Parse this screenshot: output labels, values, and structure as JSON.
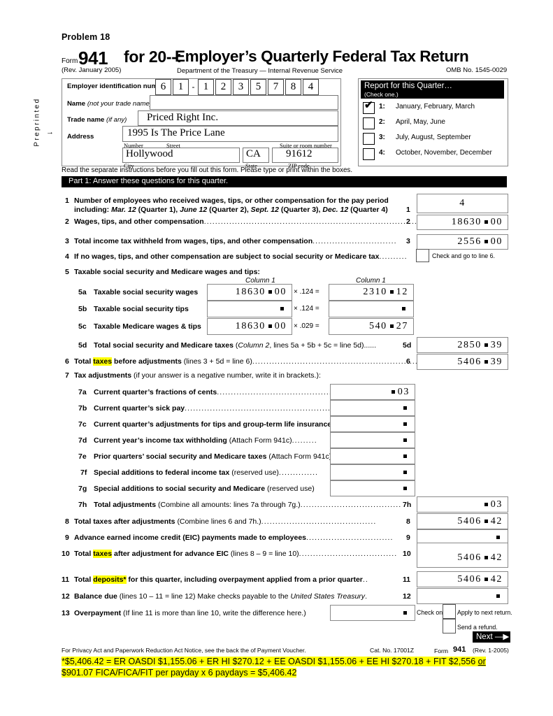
{
  "document": {
    "problem_title": "Problem 18",
    "form_word": "Form",
    "form_number": "941",
    "form_for_year": "for 20--:",
    "form_title": "Employer’s Quarterly Federal Tax Return",
    "revision": "(Rev. January 2005)",
    "department": "Department of the Treasury — Internal Revenue Service",
    "omb": "OMB No. 1545-0029",
    "preprinted_label": "Preprinted",
    "preprinted_arrow": "→",
    "read_instructions": "Read the separate instructions before you fill out this form. Please type or print within the boxes."
  },
  "entity": {
    "ein_label": "Employer identification number",
    "ein_digits": [
      "6",
      "1",
      "1",
      "2",
      "3",
      "5",
      "7",
      "8",
      "4"
    ],
    "ein_separator": "-",
    "name_label": "Name",
    "name_hint": "(not your trade name)",
    "name_value": "",
    "trade_label": "Trade name",
    "trade_hint": "(if any)",
    "trade_value": "Priced Right Inc.",
    "address_label": "Address",
    "address_value": "1995 Is The Price Lane",
    "sub_number": "Number",
    "sub_street": "Street",
    "sub_suite": "Suite or room number",
    "city_value": "Hollywood",
    "state_value": "CA",
    "zip_value": "91612",
    "sub_city": "City",
    "sub_state": "State",
    "sub_zip": "ZIP code"
  },
  "quarter": {
    "title": "Report for this Quarter…",
    "subtitle": "(Check one.)",
    "checkmark": "✔",
    "options": [
      {
        "num": "1:",
        "label": "January, February, March",
        "checked": true
      },
      {
        "num": "2:",
        "label": "April, May, June",
        "checked": false
      },
      {
        "num": "3:",
        "label": "July, August, September",
        "checked": false
      },
      {
        "num": "4:",
        "label": "October, November, December",
        "checked": false
      }
    ]
  },
  "part1": {
    "header": "Part 1: Answer these questions for this quarter."
  },
  "lines": {
    "l1": {
      "num": "1",
      "text_a": "Number of employees who received wages, tips, or other compensation for the pay period",
      "text_b_pre": "including: ",
      "text_b_1": "Mar. 12",
      "text_b_2": " (Quarter 1), ",
      "text_b_3": "June 12",
      "text_b_4": " (Quarter 2), ",
      "text_b_5": "Sept. 12",
      "text_b_6": " (Quarter 3), ",
      "text_b_7": "Dec. 12",
      "text_b_8": " (Quarter 4)",
      "ref": "1",
      "value": "4"
    },
    "l2": {
      "num": "2",
      "text": "Wages, tips, and other compensation",
      "ref": "2",
      "whole": "18630",
      "cents": "00"
    },
    "l3": {
      "num": "3",
      "text": "Total income tax withheld from wages, tips, and other compensation",
      "ref": "3",
      "whole": "2556",
      "cents": "00"
    },
    "l4": {
      "num": "4",
      "text": "If no wages, tips, and other compensation are subject to social security or Medicare tax",
      "note": "Check and go to line 6."
    },
    "l5": {
      "num": "5",
      "text": "Taxable social security and Medicare wages and tips:",
      "col1": "Column 1",
      "col2": "Column 1"
    },
    "l5a": {
      "num": "5a",
      "text": "Taxable social security wages",
      "c1_whole": "18630",
      "c1_cents": "00",
      "mult": "× .124 =",
      "c2_whole": "2310",
      "c2_cents": "12"
    },
    "l5b": {
      "num": "5b",
      "text": "Taxable social security tips",
      "c1_whole": "",
      "c1_cents": "",
      "mult": "× .124 =",
      "c2_whole": "",
      "c2_cents": ""
    },
    "l5c": {
      "num": "5c",
      "text": "Taxable Medicare wages & tips",
      "c1_whole": "18630",
      "c1_cents": "00",
      "mult": "× .029 =",
      "c2_whole": "540",
      "c2_cents": "27"
    },
    "l5d": {
      "num": "5d",
      "text": "Total social security and Medicare taxes",
      "paren_i": "Column 2",
      "paren_r": ", lines 5a + 5b + 5c = line 5d)......",
      "ref": "5d",
      "whole": "2850",
      "cents": "39"
    },
    "l6": {
      "num": "6",
      "t1": "Total ",
      "hl": "taxes",
      "t2": " before adjustments ",
      "paren": "(lines 3 + 5d = line 6)",
      "ref": "6",
      "whole": "5406",
      "cents": "39"
    },
    "l7": {
      "num": "7",
      "text": "Tax adjustments ",
      "paren": "(if your answer is a negative number, write it in brackets.):"
    },
    "l7a": {
      "num": "7a",
      "text": "Current quarter’s fractions of cents",
      "whole": "",
      "cents": "03"
    },
    "l7b": {
      "num": "7b",
      "text": "Current quarter’s sick pay",
      "whole": "",
      "cents": ""
    },
    "l7c": {
      "num": "7c",
      "text": "Current quarter’s adjustments for tips and group-term life insurance",
      "whole": "",
      "cents": ""
    },
    "l7d": {
      "num": "7d",
      "text": "Current year’s income tax withholding ",
      "paren": "(Attach Form 941c)",
      "whole": "",
      "cents": ""
    },
    "l7e": {
      "num": "7e",
      "text": "Prior quarters’ social security and Medicare taxes ",
      "paren": "(Attach Form 941c)",
      "whole": "",
      "cents": ""
    },
    "l7f": {
      "num": "7f",
      "text": "Special additions to federal income tax ",
      "paren": "(reserved use)",
      "whole": "",
      "cents": ""
    },
    "l7g": {
      "num": "7g",
      "text": "Special additions to social security and Medicare ",
      "paren": "(reserved use)",
      "whole": "",
      "cents": ""
    },
    "l7h": {
      "num": "7h",
      "text": "Total adjustments ",
      "paren": "(Combine all amounts: lines 7a through 7g.)",
      "ref": "7h",
      "whole": "",
      "cents": "03"
    },
    "l8": {
      "num": "8",
      "text": "Total taxes after adjustments ",
      "paren": "(Combine lines 6 and 7h.)",
      "ref": "8",
      "whole": "5406",
      "cents": "42"
    },
    "l9": {
      "num": "9",
      "text": "Advance earned income credit (EIC) payments made to employees",
      "ref": "9",
      "whole": "",
      "cents": ""
    },
    "l10": {
      "num": "10",
      "t1": "Total ",
      "hl": "taxes",
      "t2": " after adjustment for advance EIC ",
      "paren": "(lines 8 – 9 = line 10)",
      "ref": "10",
      "whole": "5406",
      "cents": "42"
    },
    "l11": {
      "num": "11",
      "t1": "Total ",
      "hl": "deposits*",
      "t2": " for this quarter, including overpayment applied from a prior quarter",
      "ref": "11",
      "whole": "5406",
      "cents": "42"
    },
    "l12": {
      "num": "12",
      "text": "Balance due ",
      "paren_a": "(lines 10 – 11 = line 12) Make checks payable to the ",
      "paren_i": "United States Treasury",
      "paren_b": ".",
      "ref": "12",
      "whole": "",
      "cents": ""
    },
    "l13": {
      "num": "13",
      "text": "Overpayment ",
      "paren": "(If line 11 is more than line 10, write the difference here.)",
      "whole": "",
      "cents": "",
      "check_one": "Check one",
      "opt1": "Apply to next return.",
      "opt2": "Send a refund."
    }
  },
  "footer": {
    "next_label": "Next —▶",
    "privacy": "For Privacy Act and Paperwork Reduction Act Notice, see the back the of Payment Voucher.",
    "cat_no": "Cat.  No. 17001Z",
    "form_word": "Form",
    "form_number": "941",
    "revision": "(Rev. 1-2005)",
    "note_line1_a": "*$5,406.42 = ER OASDI $1,155.06 + ER HI $270.12 + EE OASDI $1,155.06 + EE HI $270.18 + FIT $2,556 ",
    "note_line1_or": "or",
    "note_line2": "$901.07 FICA/FICA/FIT per payday x 6 paydays = $5,406.42"
  },
  "colors": {
    "highlight": "#ffff00",
    "bar": "#000000",
    "box_border": "#8a8a8a"
  }
}
